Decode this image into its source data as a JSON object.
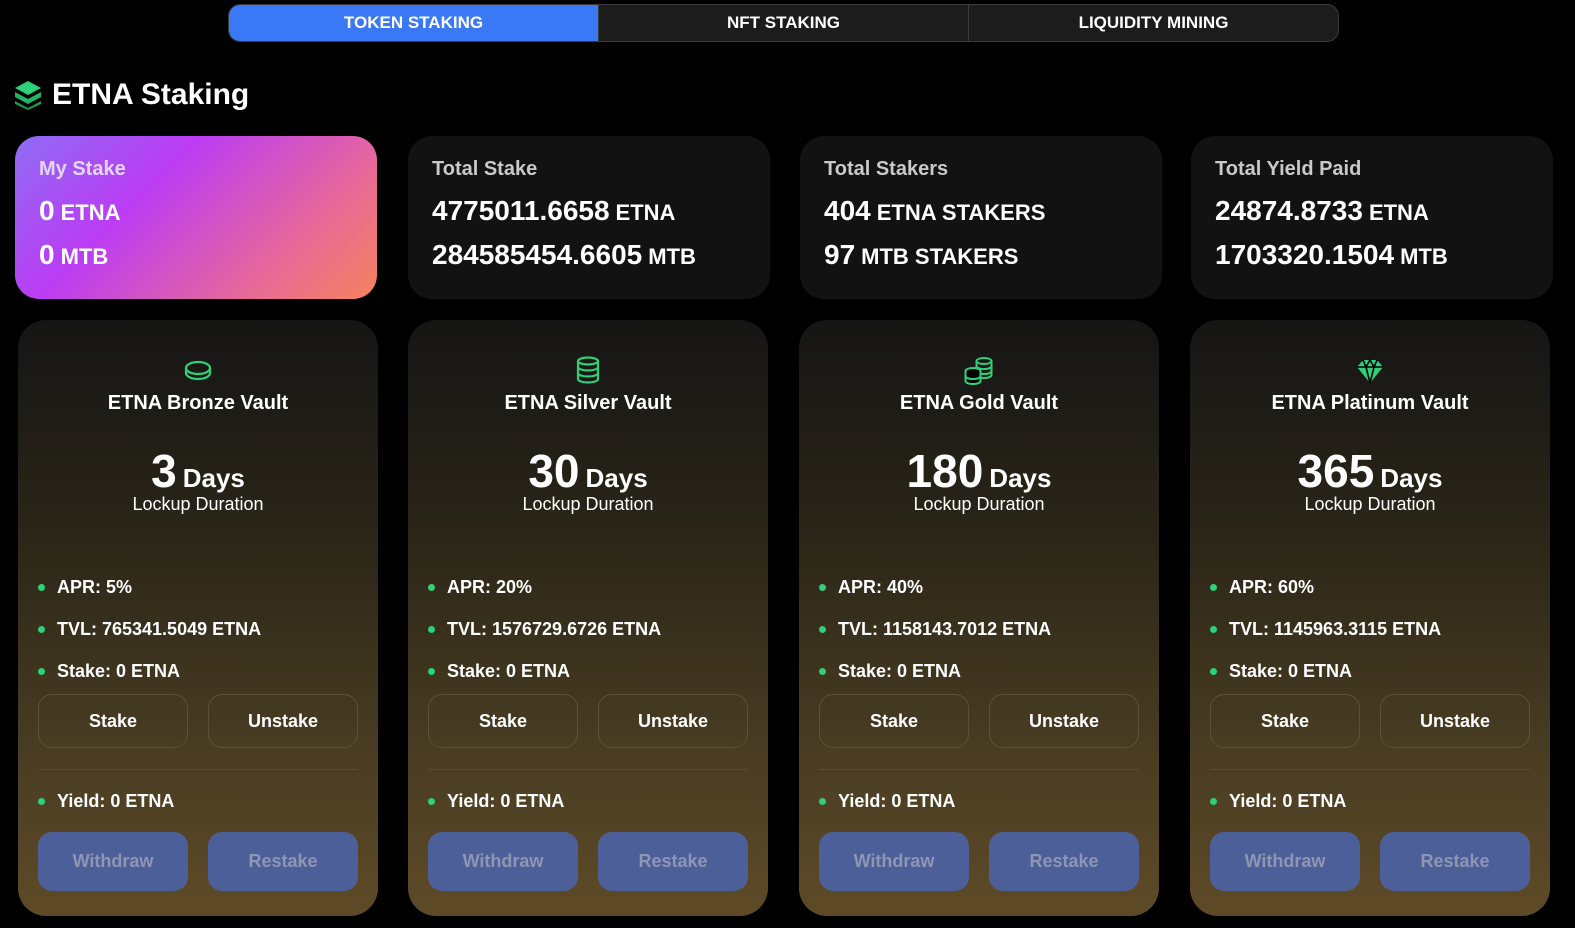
{
  "tabs": [
    {
      "label": "TOKEN STAKING",
      "active": true
    },
    {
      "label": "NFT STAKING",
      "active": false
    },
    {
      "label": "LIQUIDITY MINING",
      "active": false
    }
  ],
  "title": "ETNA Staking",
  "accent_color": "#2fd07a",
  "active_tab_color": "#3a78f5",
  "stats": [
    {
      "label": "My Stake",
      "row1_value": "0",
      "row1_unit": "ETNA",
      "row2_value": "0",
      "row2_unit": "MTB"
    },
    {
      "label": "Total Stake",
      "row1_value": "4775011.6658",
      "row1_unit": "ETNA",
      "row2_value": "284585454.6605",
      "row2_unit": "MTB"
    },
    {
      "label": "Total Stakers",
      "row1_value": "404",
      "row1_unit": "ETNA STAKERS",
      "row2_value": "97",
      "row2_unit": "MTB STAKERS"
    },
    {
      "label": "Total Yield Paid",
      "row1_value": "24874.8733",
      "row1_unit": "ETNA",
      "row2_value": "1703320.1504",
      "row2_unit": "MTB"
    }
  ],
  "vaults": [
    {
      "icon": "coin-icon",
      "name": "ETNA Bronze Vault",
      "days": "3",
      "days_unit": "Days",
      "lock_label": "Lockup Duration",
      "apr": "APR: 5%",
      "tvl": "TVL: 765341.5049 ETNA",
      "stake": "Stake: 0 ETNA",
      "yield": "Yield: 0 ETNA",
      "stake_btn": "Stake",
      "unstake_btn": "Unstake",
      "withdraw_btn": "Withdraw",
      "restake_btn": "Restake"
    },
    {
      "icon": "coin-stack-icon",
      "name": "ETNA Silver Vault",
      "days": "30",
      "days_unit": "Days",
      "lock_label": "Lockup Duration",
      "apr": "APR: 20%",
      "tvl": "TVL: 1576729.6726 ETNA",
      "stake": "Stake: 0 ETNA",
      "yield": "Yield: 0 ETNA",
      "stake_btn": "Stake",
      "unstake_btn": "Unstake",
      "withdraw_btn": "Withdraw",
      "restake_btn": "Restake"
    },
    {
      "icon": "coins-icon",
      "name": "ETNA Gold Vault",
      "days": "180",
      "days_unit": "Days",
      "lock_label": "Lockup Duration",
      "apr": "APR: 40%",
      "tvl": "TVL: 1158143.7012 ETNA",
      "stake": "Stake: 0 ETNA",
      "yield": "Yield: 0 ETNA",
      "stake_btn": "Stake",
      "unstake_btn": "Unstake",
      "withdraw_btn": "Withdraw",
      "restake_btn": "Restake"
    },
    {
      "icon": "diamond-icon",
      "name": "ETNA Platinum Vault",
      "days": "365",
      "days_unit": "Days",
      "lock_label": "Lockup Duration",
      "apr": "APR: 60%",
      "tvl": "TVL: 1145963.3115 ETNA",
      "stake": "Stake: 0 ETNA",
      "yield": "Yield: 0 ETNA",
      "stake_btn": "Stake",
      "unstake_btn": "Unstake",
      "withdraw_btn": "Withdraw",
      "restake_btn": "Restake"
    }
  ]
}
